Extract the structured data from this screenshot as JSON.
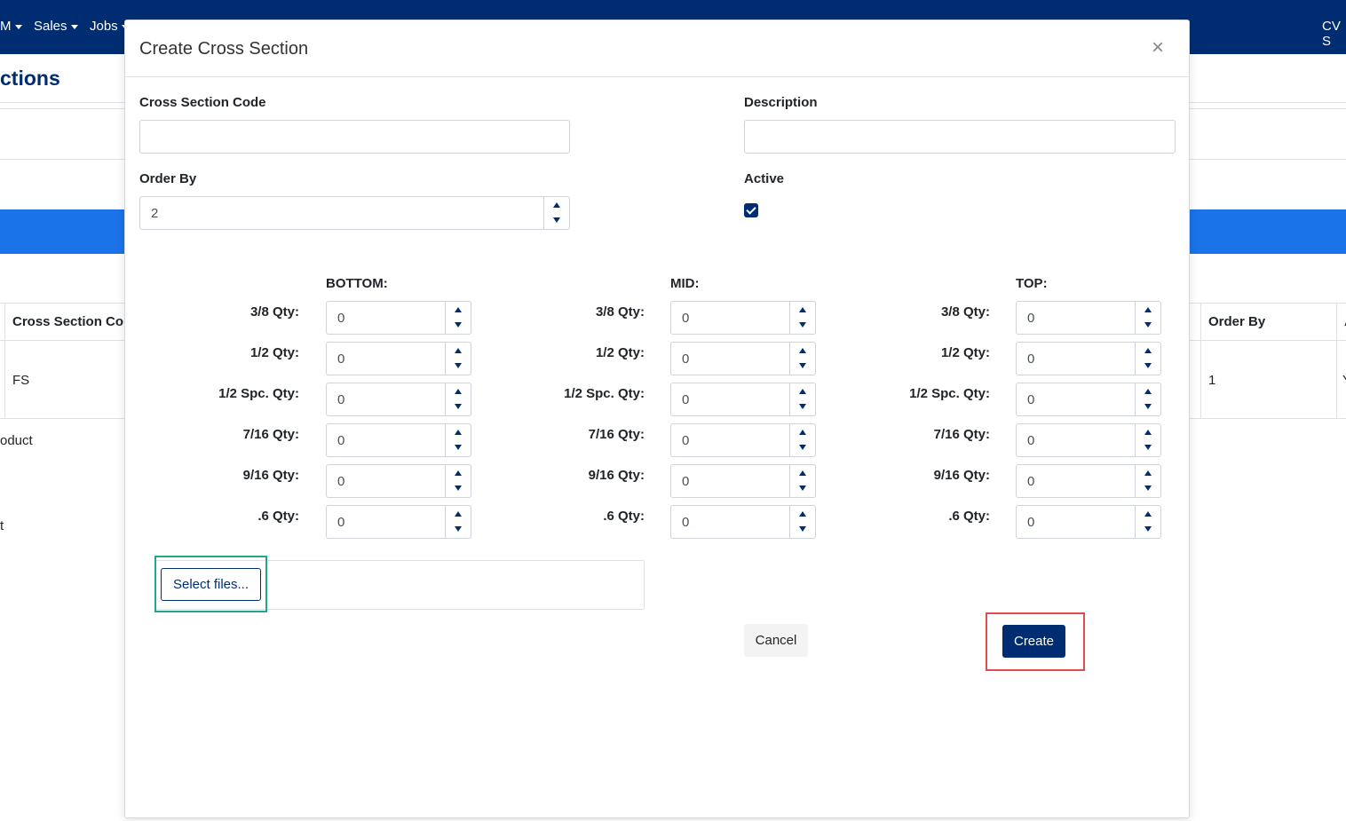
{
  "nav": {
    "items": [
      "M",
      "Sales",
      "Jobs"
    ],
    "right": "CV S"
  },
  "page": {
    "title": "ctions"
  },
  "table": {
    "headers": [
      "Cross Section Co",
      "Order By",
      "A"
    ],
    "row": [
      "FS",
      "1",
      "Y"
    ]
  },
  "bg_text": [
    "oduct",
    "t"
  ],
  "modal": {
    "title": "Create Cross Section",
    "close": "×",
    "code_label": "Cross Section Code",
    "code_value": "",
    "description_label": "Description",
    "description_value": "",
    "order_label": "Order By",
    "order_value": "2",
    "active_label": "Active",
    "active_checked": true,
    "sections": [
      {
        "header": "BOTTOM:",
        "rows": [
          {
            "label": "3/8 Qty:",
            "value": "0"
          },
          {
            "label": "1/2 Qty:",
            "value": "0"
          },
          {
            "label": "1/2 Spc. Qty:",
            "value": "0"
          },
          {
            "label": "7/16 Qty:",
            "value": "0"
          },
          {
            "label": "9/16 Qty:",
            "value": "0"
          },
          {
            "label": ".6 Qty:",
            "value": "0"
          }
        ]
      },
      {
        "header": "MID:",
        "rows": [
          {
            "label": "3/8 Qty:",
            "value": "0"
          },
          {
            "label": "1/2 Qty:",
            "value": "0"
          },
          {
            "label": "1/2 Spc. Qty:",
            "value": "0"
          },
          {
            "label": "7/16 Qty:",
            "value": "0"
          },
          {
            "label": "9/16 Qty:",
            "value": "0"
          },
          {
            "label": ".6 Qty:",
            "value": "0"
          }
        ]
      },
      {
        "header": "TOP:",
        "rows": [
          {
            "label": "3/8 Qty:",
            "value": "0"
          },
          {
            "label": "1/2 Qty:",
            "value": "0"
          },
          {
            "label": "1/2 Spc. Qty:",
            "value": "0"
          },
          {
            "label": "7/16 Qty:",
            "value": "0"
          },
          {
            "label": "9/16 Qty:",
            "value": "0"
          },
          {
            "label": ".6 Qty:",
            "value": "0"
          }
        ]
      }
    ],
    "select_files": "Select files...",
    "cancel": "Cancel",
    "create": "Create"
  },
  "colors": {
    "brand": "#002d72",
    "band": "#1a73e8",
    "highlight_green": "#1fa98a",
    "highlight_red": "#e04b50"
  }
}
